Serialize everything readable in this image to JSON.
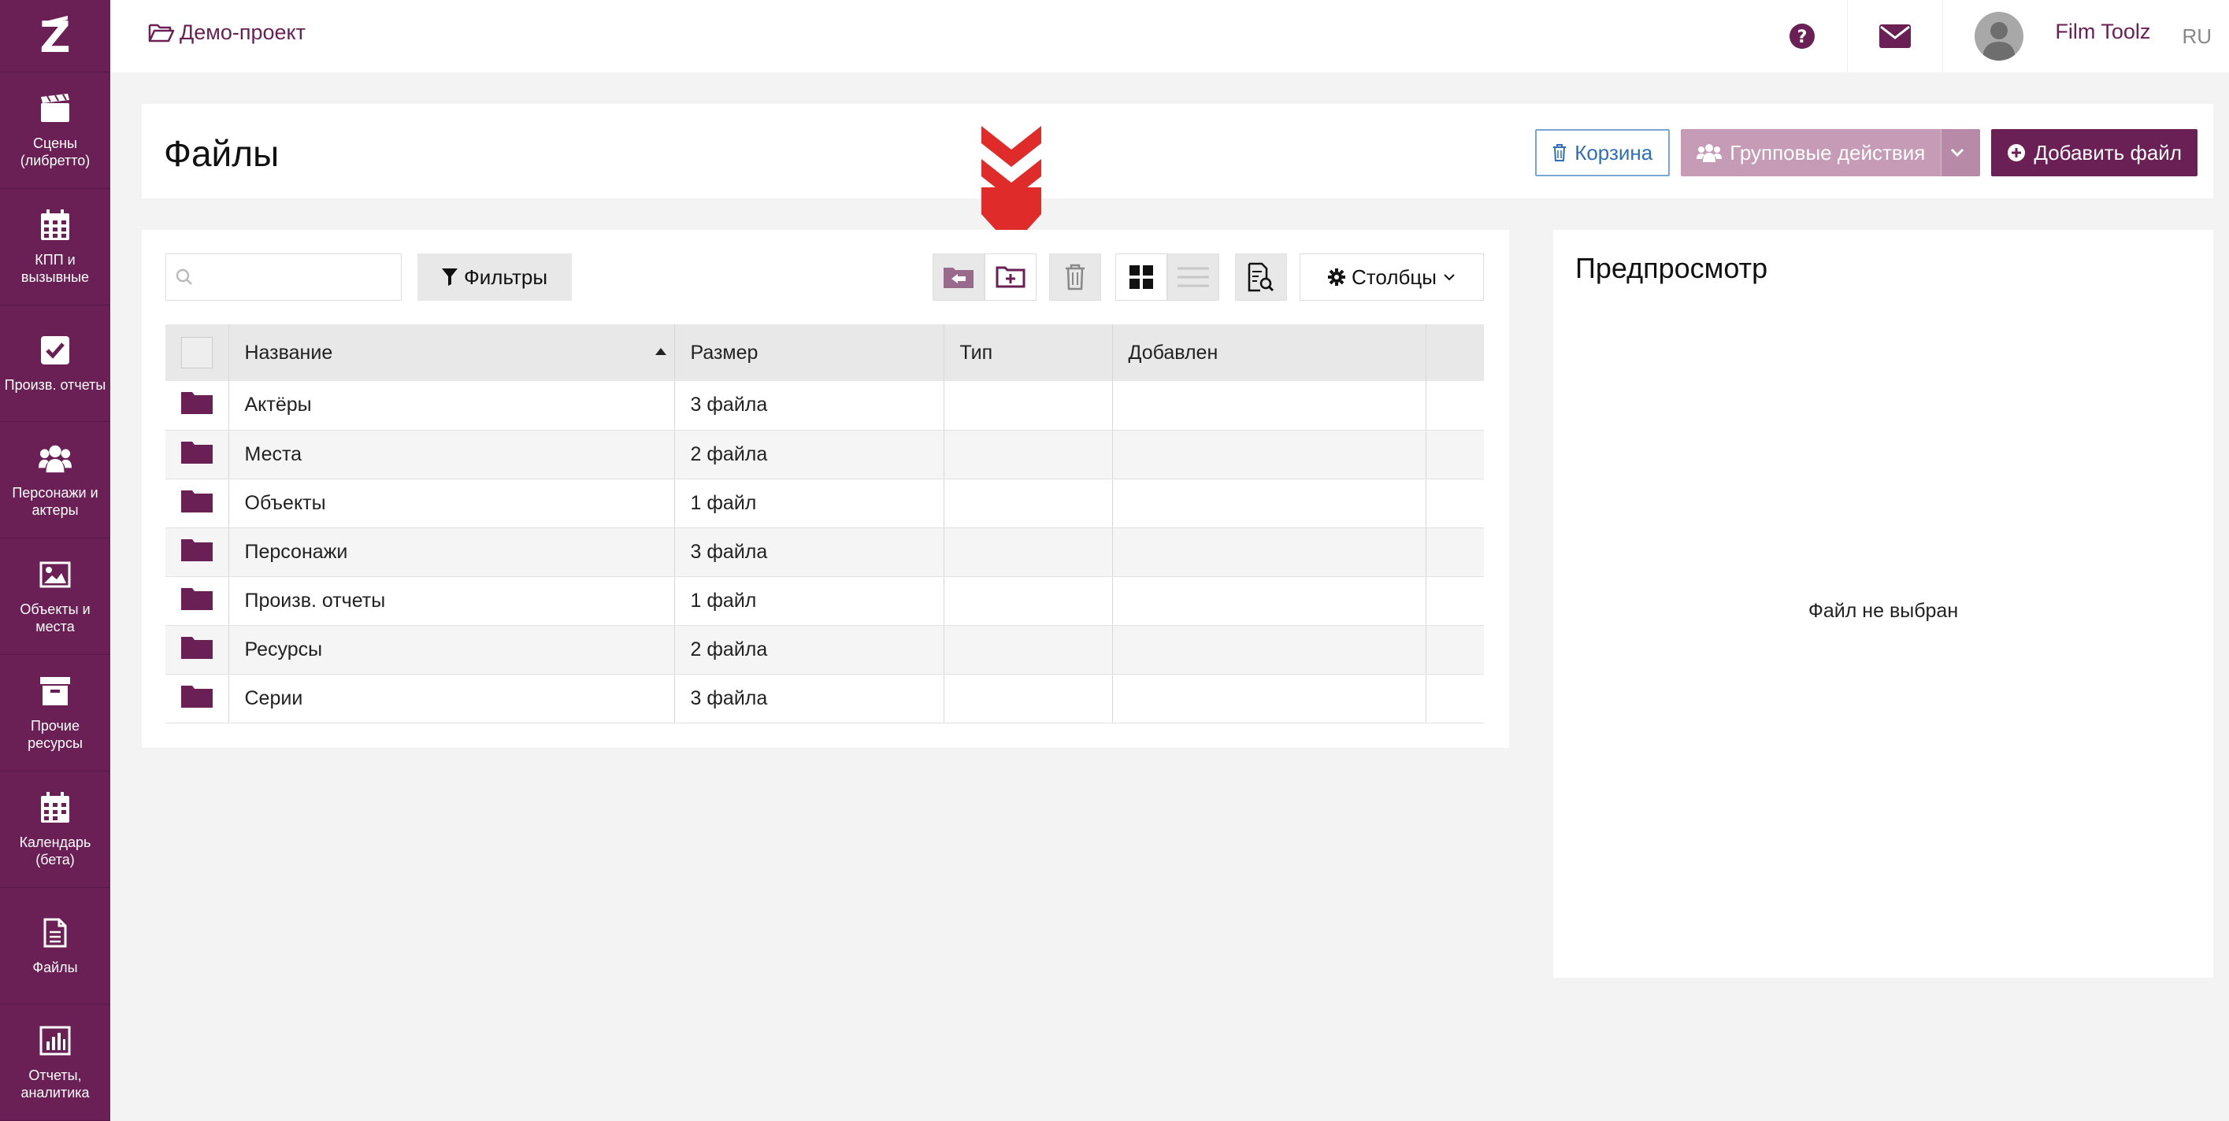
{
  "sidebar": {
    "items": [
      {
        "label": "Сцены (либретто)",
        "icon": "clapperboard-icon"
      },
      {
        "label": "КПП и вызывные",
        "icon": "calendar-grid-icon"
      },
      {
        "label": "Произв. отчеты",
        "icon": "checkbox-icon"
      },
      {
        "label": "Персонажи и актеры",
        "icon": "people-icon"
      },
      {
        "label": "Объекты и места",
        "icon": "image-icon"
      },
      {
        "label": "Прочие ресурсы",
        "icon": "archive-box-icon"
      },
      {
        "label": "Календарь (бета)",
        "icon": "calendar-icon"
      },
      {
        "label": "Файлы",
        "icon": "file-icon"
      },
      {
        "label": "Отчеты, аналитика",
        "icon": "bar-chart-icon"
      }
    ]
  },
  "topbar": {
    "project": "Демо-проект",
    "user_name": "Film Toolz",
    "language": "RU"
  },
  "page": {
    "title": "Файлы",
    "trash_label": "Корзина",
    "group_actions_label": "Групповые действия",
    "add_file_label": "Добавить файл"
  },
  "toolbar": {
    "search_placeholder": "",
    "filters_label": "Фильтры",
    "columns_label": "Столбцы"
  },
  "table": {
    "headers": [
      "Название",
      "Размер",
      "Тип",
      "Добавлен"
    ],
    "rows": [
      {
        "name": "Актёры",
        "size": "3 файла",
        "type": "",
        "added": ""
      },
      {
        "name": "Места",
        "size": "2 файла",
        "type": "",
        "added": ""
      },
      {
        "name": "Объекты",
        "size": "1 файл",
        "type": "",
        "added": ""
      },
      {
        "name": "Персонажи",
        "size": "3 файла",
        "type": "",
        "added": ""
      },
      {
        "name": "Произв. отчеты",
        "size": "1 файл",
        "type": "",
        "added": ""
      },
      {
        "name": "Ресурсы",
        "size": "2 файла",
        "type": "",
        "added": ""
      },
      {
        "name": "Серии",
        "size": "3 файла",
        "type": "",
        "added": ""
      }
    ]
  },
  "preview": {
    "title": "Предпросмотр",
    "empty_text": "Файл не выбран"
  },
  "colors": {
    "brand": "#6a1f55",
    "brand_light": "#c59bb6",
    "arrow": "#e02b2b"
  }
}
